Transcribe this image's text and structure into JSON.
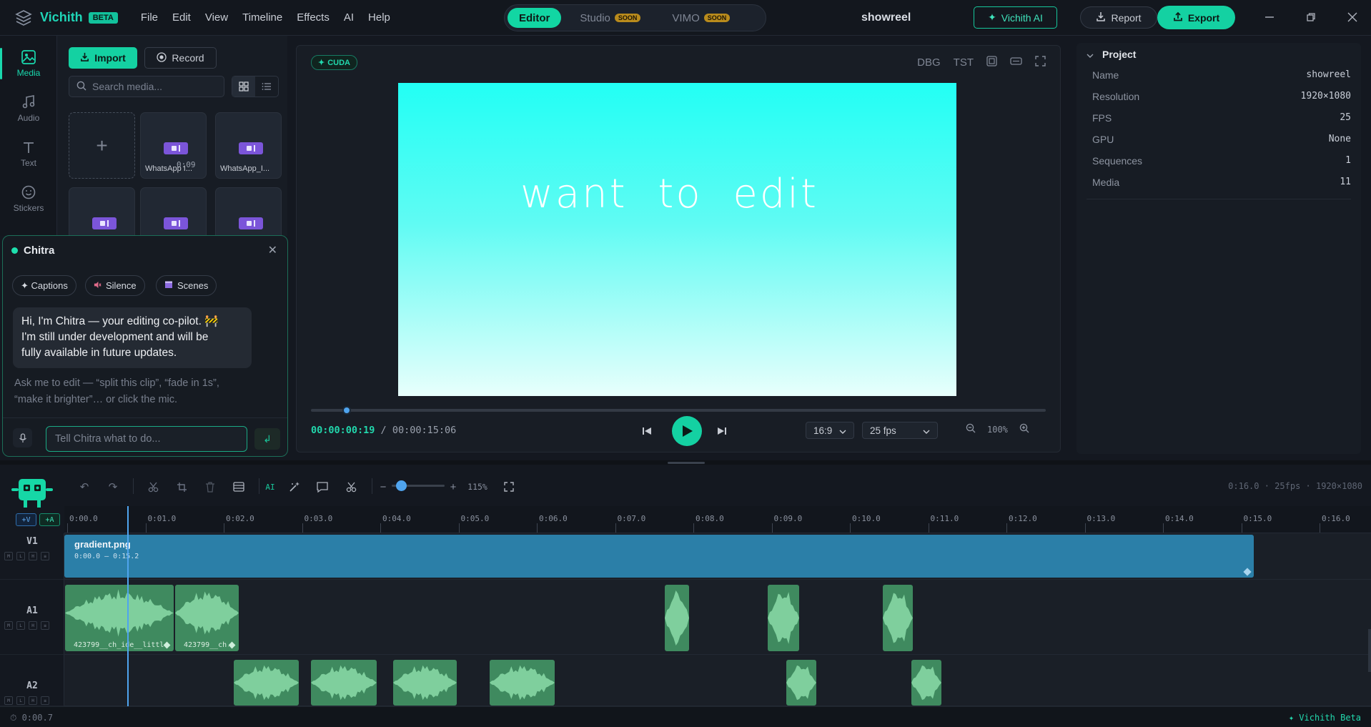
{
  "app": {
    "name": "Vichith",
    "badge": "BETA",
    "menu": [
      "File",
      "Edit",
      "View",
      "Timeline",
      "Effects",
      "AI",
      "Help"
    ],
    "modes": [
      {
        "label": "Editor",
        "active": true,
        "soon": ""
      },
      {
        "label": "Studio",
        "active": false,
        "soon": "SOON"
      },
      {
        "label": "VIMO",
        "active": false,
        "soon": "SOON"
      }
    ],
    "project_title": "showreel",
    "ai_button": "Vichith AI",
    "report_button": "Report",
    "export_button": "Export",
    "accent": "#14d1a2"
  },
  "rail": [
    {
      "label": "Media",
      "icon": "image-icon",
      "active": true
    },
    {
      "label": "Audio",
      "icon": "music-note-icon",
      "active": false
    },
    {
      "label": "Text",
      "icon": "text-icon",
      "active": false
    },
    {
      "label": "Stickers",
      "icon": "smiley-icon",
      "active": false
    }
  ],
  "media": {
    "import_label": "Import",
    "record_label": "Record",
    "search_placeholder": "Search media...",
    "tiles": [
      {
        "name": "WhatsApp I...",
        "duration": "0:09"
      },
      {
        "name": "WhatsApp_I...",
        "duration": ""
      },
      {
        "name": "",
        "duration": ""
      },
      {
        "name": "",
        "duration": ""
      },
      {
        "name": "",
        "duration": ""
      }
    ]
  },
  "chitra": {
    "title": "Chitra",
    "chips": [
      "✦ Captions",
      "Silence",
      "Scenes"
    ],
    "message_line1": "Hi, I'm Chitra — your editing co-pilot. 🚧",
    "message_line2": "I'm still under development and will be",
    "message_line3": "fully available in future updates.",
    "hint_line1": "Ask me to edit — “split this clip”, “fade in 1s”,",
    "hint_line2": "“make it brighter”… or click the mic.",
    "input_placeholder": "Tell Chitra what to do..."
  },
  "preview": {
    "badge": "CUDA",
    "tools": [
      "DBG",
      "TST"
    ],
    "canvas_text": "want to edit",
    "current_time": "00:00:00:19",
    "separator": "/",
    "total_time": "00:00:15:06",
    "playhead_fraction": 0.049,
    "aspect": "16:9",
    "fps": "25 fps",
    "zoom": "100%"
  },
  "project": {
    "title": "Project",
    "rows": [
      {
        "k": "Name",
        "v": "showreel"
      },
      {
        "k": "Resolution",
        "v": "1920×1080"
      },
      {
        "k": "FPS",
        "v": "25"
      },
      {
        "k": "GPU",
        "v": "None"
      },
      {
        "k": "Sequences",
        "v": "1"
      },
      {
        "k": "Media",
        "v": "11"
      }
    ]
  },
  "timeline": {
    "ai_label": "AI",
    "zoom_label": "115%",
    "info": "0:16.0 · 25fps · 1920×1080",
    "add_video": "+V",
    "add_audio": "+A",
    "ticks": [
      "0:00.0",
      "0:01.0",
      "0:02.0",
      "0:03.0",
      "0:04.0",
      "0:05.0",
      "0:06.0",
      "0:07.0",
      "0:08.0",
      "0:09.0",
      "0:10.0",
      "0:11.0",
      "0:12.0",
      "0:13.0",
      "0:14.0",
      "0:15.0",
      "0:16.0"
    ],
    "tracks": [
      "V1",
      "A1",
      "A2"
    ],
    "track_buttons": [
      "M",
      "L",
      "H",
      "≡"
    ],
    "video_clip": {
      "name": "gradient.png",
      "range": "0:00.0 — 0:15.2"
    },
    "a1_clip_labels": [
      "423799__ch_ide__littl",
      "423799__ch..."
    ]
  },
  "status": {
    "left": "⏱ 0:00.7",
    "right": "✦ Vichith Beta"
  }
}
